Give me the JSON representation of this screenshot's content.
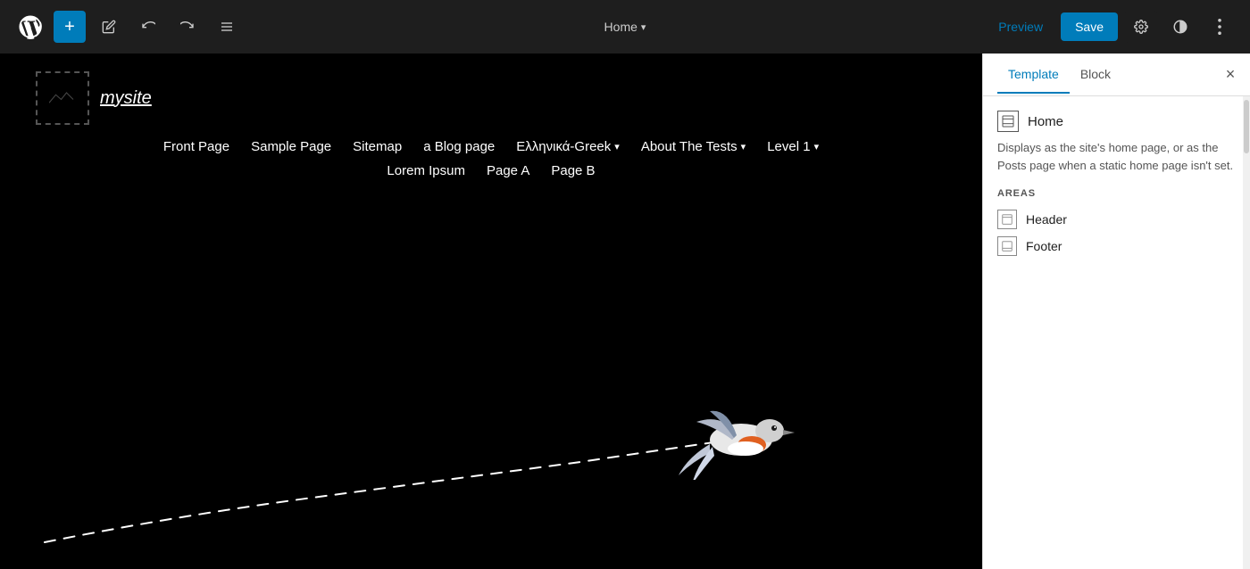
{
  "toolbar": {
    "add_label": "+",
    "edit_icon": "✏",
    "undo_icon": "↩",
    "redo_icon": "↪",
    "list_icon": "≡",
    "page_title": "Home",
    "dropdown_icon": "▾",
    "preview_label": "Preview",
    "save_label": "Save",
    "settings_icon": "⚙",
    "contrast_icon": "◑",
    "more_icon": "⋮"
  },
  "canvas": {
    "site_name": "mysite",
    "nav_items": [
      {
        "label": "Front Page",
        "has_dropdown": false
      },
      {
        "label": "Sample Page",
        "has_dropdown": false
      },
      {
        "label": "Sitemap",
        "has_dropdown": false
      },
      {
        "label": "a Blog page",
        "has_dropdown": false
      },
      {
        "label": "Ελληνικά-Greek",
        "has_dropdown": true
      },
      {
        "label": "About The Tests",
        "has_dropdown": true
      },
      {
        "label": "Level 1",
        "has_dropdown": true
      }
    ],
    "sub_nav_items": [
      {
        "label": "Lorem Ipsum"
      },
      {
        "label": "Page A"
      },
      {
        "label": "Page B"
      }
    ]
  },
  "sidebar": {
    "tab_template": "Template",
    "tab_block": "Block",
    "close_icon": "×",
    "active_tab": "template",
    "home_label": "Home",
    "home_description": "Displays as the site's home page, or as the Posts page when a static home page isn't set.",
    "areas_label": "AREAS",
    "areas": [
      {
        "name": "Header"
      },
      {
        "name": "Footer"
      }
    ]
  }
}
